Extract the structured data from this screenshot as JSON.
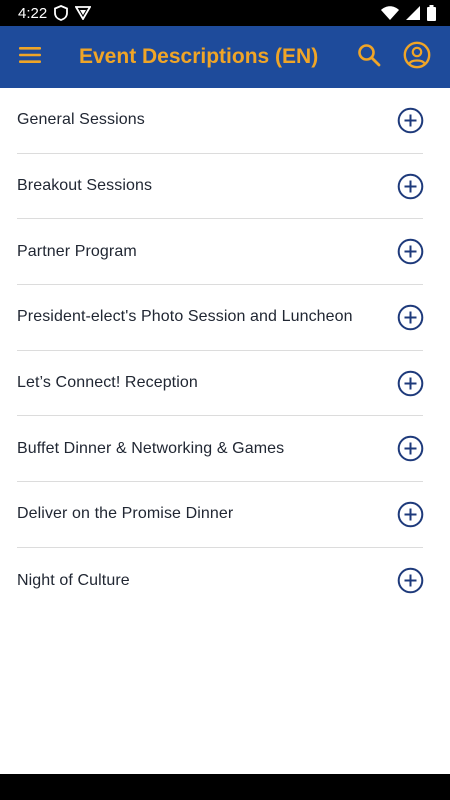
{
  "status_bar": {
    "time": "4:22"
  },
  "app_bar": {
    "title": "Event Descriptions (EN)"
  },
  "events": [
    {
      "label": "General Sessions"
    },
    {
      "label": "Breakout Sessions"
    },
    {
      "label": "Partner Program"
    },
    {
      "label": "President-elect's Photo Session and Luncheon"
    },
    {
      "label": "Let’s Connect! Reception"
    },
    {
      "label": "Buffet Dinner & Networking & Games"
    },
    {
      "label": "Deliver on the Promise Dinner"
    },
    {
      "label": "Night of Culture"
    }
  ],
  "icons": {
    "menu": "hamburger-menu-icon",
    "search": "search-icon",
    "account": "account-circle-icon",
    "expand": "plus-circle-icon"
  },
  "colors": {
    "app_bar": "#1e4b9b",
    "accent": "#f0a527",
    "plus_icon": "#1e3a7b",
    "text": "#212733",
    "divider": "#dcdcdc"
  }
}
